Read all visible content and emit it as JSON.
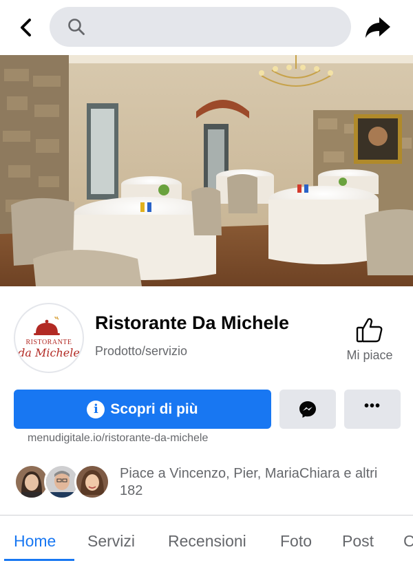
{
  "topbar": {
    "search_placeholder": "",
    "back_icon": "chevron-left-icon",
    "share_icon": "share-arrow-icon",
    "search_icon": "search-icon"
  },
  "page": {
    "name": "Ristorante Da Michele",
    "category": "Prodotto/servizio",
    "logo": {
      "line1": "RISTORANTE",
      "line2": "da Michele"
    },
    "like_label": "Mi piace",
    "cta_label": "Scopri di più",
    "info_icon_glyph": "i",
    "more_label": "•••",
    "website": "menudigitale.io/ristorante-da-michele",
    "likes_text": "Piace a Vincenzo, Pier, MariaChiara e altri 182"
  },
  "tabs": [
    {
      "label": "Home",
      "active": true
    },
    {
      "label": "Servizi"
    },
    {
      "label": "Recensioni"
    },
    {
      "label": "Foto"
    },
    {
      "label": "Post"
    },
    {
      "label": "C"
    }
  ],
  "colors": {
    "accent": "#1877f2",
    "secondary_button": "#e4e6eb",
    "muted_text": "#65676b",
    "logo_red": "#b22a24"
  }
}
